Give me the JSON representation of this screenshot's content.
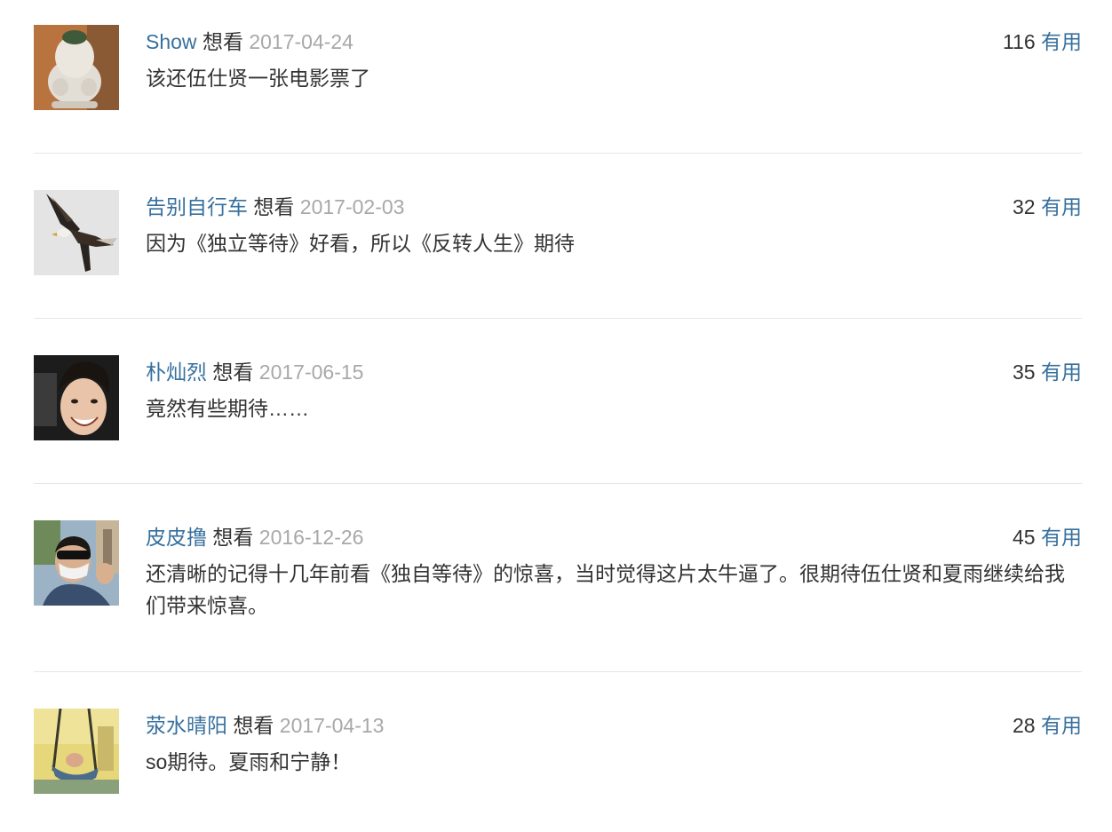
{
  "comments": [
    {
      "author": "Show",
      "status": "想看",
      "date": "2017-04-24",
      "votes": "116",
      "useful_label": "有用",
      "text": "该还伍仕贤一张电影票了",
      "avatar_icon": "figurine-avatar"
    },
    {
      "author": "告别自行车",
      "status": "想看",
      "date": "2017-02-03",
      "votes": "32",
      "useful_label": "有用",
      "text": "因为《独立等待》好看，所以《反转人生》期待",
      "avatar_icon": "eagle-avatar"
    },
    {
      "author": "朴灿烈",
      "status": "想看",
      "date": "2017-06-15",
      "votes": "35",
      "useful_label": "有用",
      "text": "竟然有些期待……",
      "avatar_icon": "smiling-face-avatar"
    },
    {
      "author": "皮皮撸",
      "status": "想看",
      "date": "2016-12-26",
      "votes": "45",
      "useful_label": "有用",
      "text": "还清晰的记得十几年前看《独自等待》的惊喜，当时觉得这片太牛逼了。很期待伍仕贤和夏雨继续给我们带来惊喜。",
      "avatar_icon": "masked-selfie-avatar"
    },
    {
      "author": "荥水晴阳",
      "status": "想看",
      "date": "2017-04-13",
      "votes": "28",
      "useful_label": "有用",
      "text": "so期待。夏雨和宁静！",
      "avatar_icon": "swing-photo-avatar"
    }
  ]
}
